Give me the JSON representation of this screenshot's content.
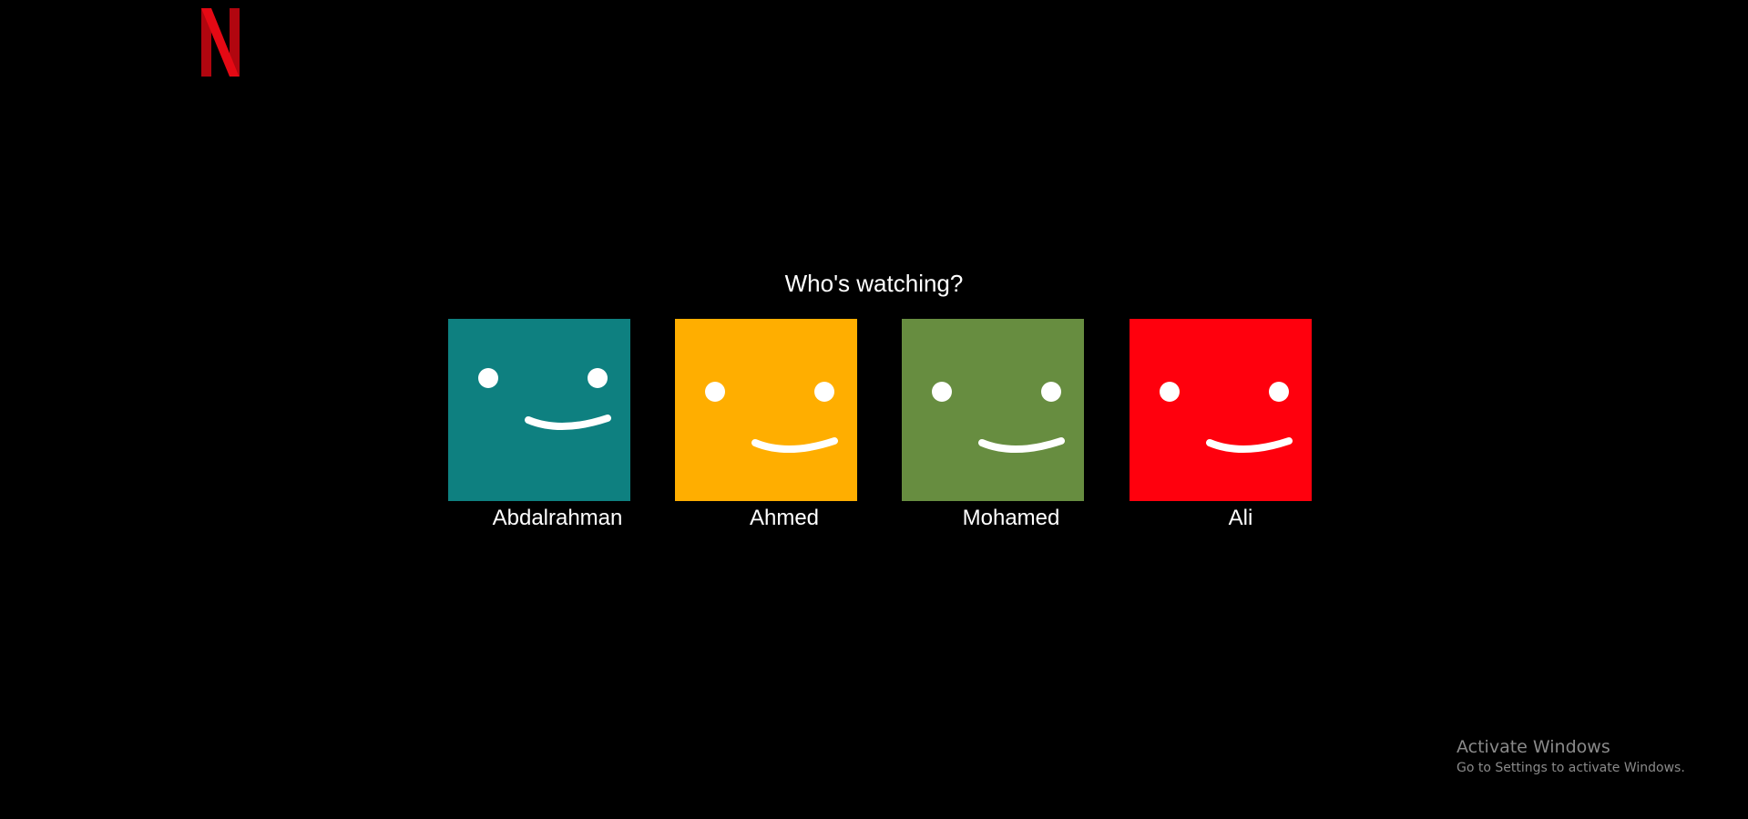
{
  "brand": {
    "logo_icon": "netflix-n-logo-icon",
    "logo_color": "#E50914",
    "logo_shadow_color": "#B1060F"
  },
  "main": {
    "heading": "Who's watching?"
  },
  "profiles": [
    {
      "name": "Abdalrahman",
      "avatar_icon": "smiley-face-icon",
      "color": "#0E8080"
    },
    {
      "name": "Ahmed",
      "avatar_icon": "smiley-face-icon",
      "color": "#FFAE00"
    },
    {
      "name": "Mohamed",
      "avatar_icon": "smiley-face-icon",
      "color": "#678D40"
    },
    {
      "name": "Ali",
      "avatar_icon": "smiley-face-icon",
      "color": "#FF000D"
    }
  ],
  "os_overlay": {
    "title": "Activate Windows",
    "subtitle": "Go to Settings to activate Windows."
  }
}
